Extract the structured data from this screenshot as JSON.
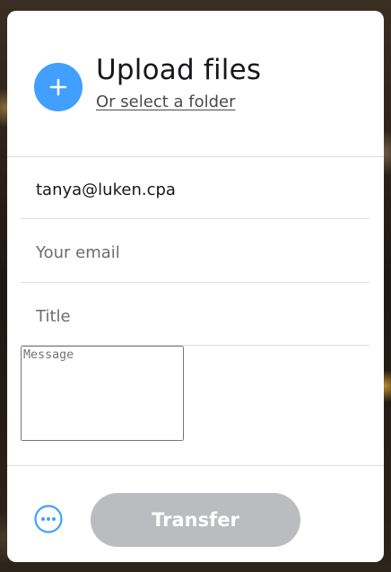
{
  "upload": {
    "title": "Upload files",
    "folder_link": "Or select a folder"
  },
  "form": {
    "recipient_value": "tanya@luken.cpa",
    "your_email_placeholder": "Your email",
    "title_placeholder": "Title",
    "message_placeholder": "Message"
  },
  "footer": {
    "transfer_label": "Transfer"
  },
  "colors": {
    "accent": "#409fff",
    "transfer_disabled": "#bbbcc0",
    "divider": "#dcdcdf"
  },
  "icons": {
    "add": "plus-icon",
    "more": "more-options-icon"
  }
}
